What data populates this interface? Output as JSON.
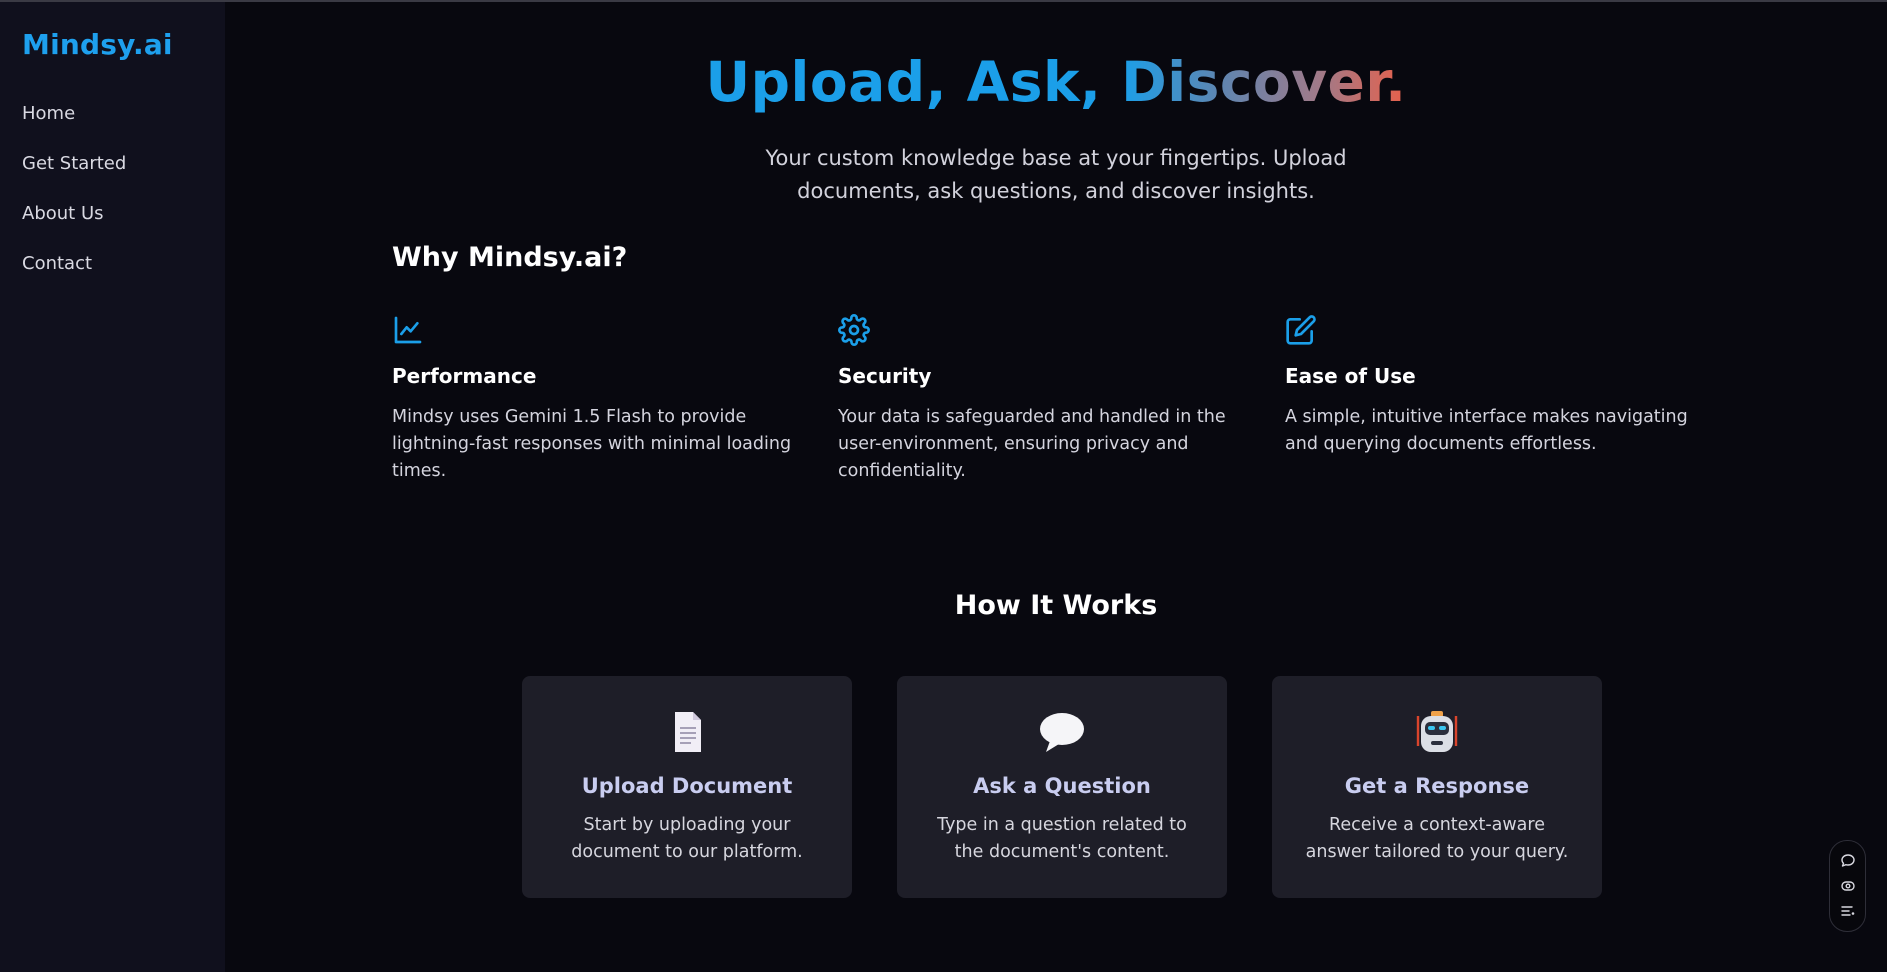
{
  "sidebar": {
    "brand": "Mindsy.ai",
    "items": [
      {
        "label": "Home"
      },
      {
        "label": "Get Started"
      },
      {
        "label": "About Us"
      },
      {
        "label": "Contact"
      }
    ]
  },
  "hero": {
    "title_part1": "Upload, Ask, ",
    "title_part2": "Discover.",
    "subtitle_line1": "Your custom knowledge base at your fingertips. Upload",
    "subtitle_line2": "documents, ask questions, and discover insights."
  },
  "why": {
    "title": "Why Mindsy.ai?",
    "features": [
      {
        "icon": "line-chart-icon",
        "title": "Performance",
        "desc": "Mindsy uses Gemini 1.5 Flash to provide lightning-fast responses with minimal loading times."
      },
      {
        "icon": "gear-icon",
        "title": "Security",
        "desc": "Your data is safeguarded and handled in the user-environment, ensuring privacy and confidentiality."
      },
      {
        "icon": "edit-icon",
        "title": "Ease of Use",
        "desc": "A simple, intuitive interface makes navigating and querying documents effortless."
      }
    ]
  },
  "how": {
    "title": "How It Works",
    "steps": [
      {
        "icon": "document-icon",
        "title": "Upload Document",
        "desc": "Start by uploading your document to our platform."
      },
      {
        "icon": "speech-bubble-icon",
        "title": "Ask a Question",
        "desc": "Type in a question related to the document's content."
      },
      {
        "icon": "robot-icon",
        "title": "Get a Response",
        "desc": "Receive a context-aware answer tailored to your query."
      }
    ]
  },
  "toolbar": {
    "icons": [
      "chat-icon",
      "view-icon",
      "list-icon"
    ]
  },
  "colors": {
    "accent": "#1b9fe9",
    "gradient_end": "#e8604a",
    "background": "#08080f",
    "sidebar": "#10101d",
    "card": "#1e1e28"
  }
}
